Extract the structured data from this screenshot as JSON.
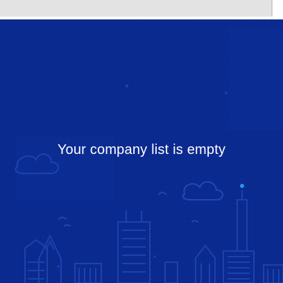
{
  "empty_state": {
    "message": "Your company list is empty"
  },
  "colors": {
    "panel_background": "#0b2a8f",
    "illustration_stroke": "#2a57c7",
    "accent_dot": "#3aa0ff",
    "topbar": "#e3e3e3"
  }
}
